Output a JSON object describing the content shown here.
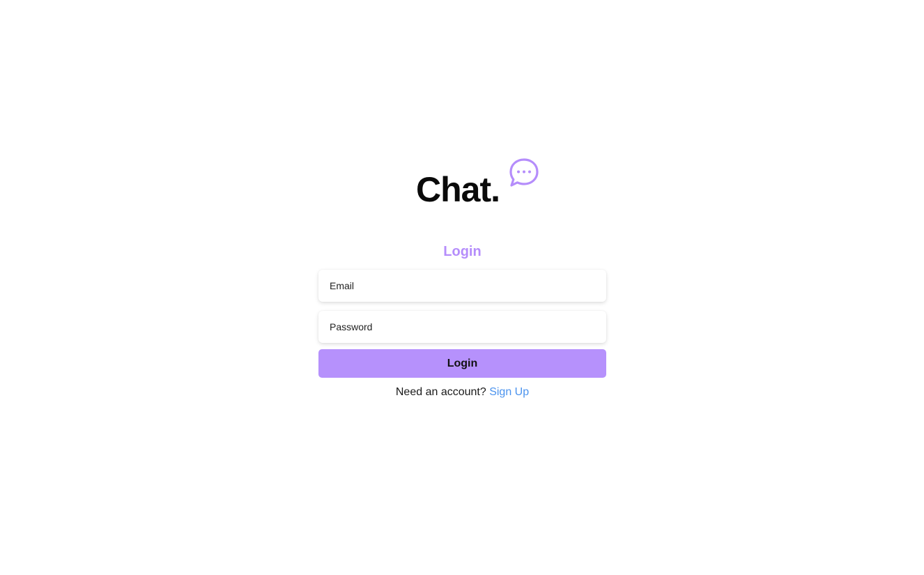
{
  "brand": {
    "name": "Chat.",
    "icon": "chat-bubble-icon",
    "icon_color": "#b58dfb"
  },
  "login_form": {
    "title": "Login",
    "email_placeholder": "Email",
    "password_placeholder": "Password",
    "submit_label": "Login",
    "accent_color": "#b691fc"
  },
  "signup": {
    "prompt": "Need an account?",
    "link_label": "Sign Up",
    "link_color": "#4b93ee"
  }
}
